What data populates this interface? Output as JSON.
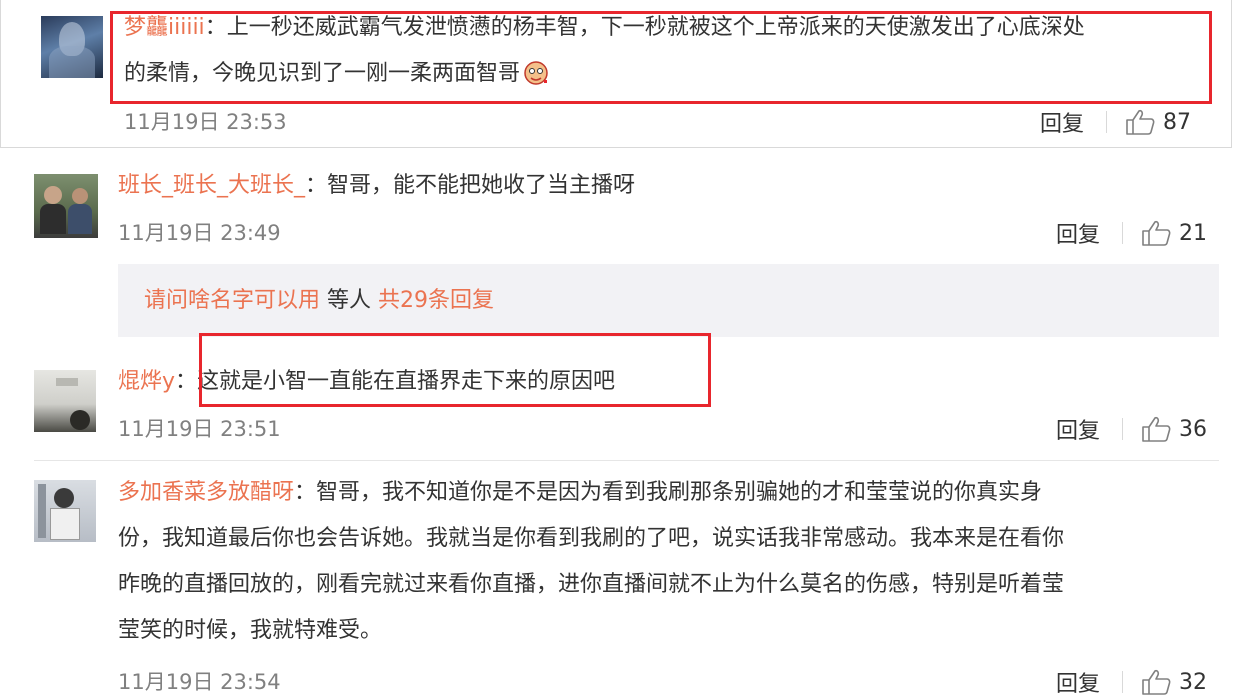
{
  "colors": {
    "username": "#eb7350",
    "highlight_box": "#e8262d",
    "time": "#808080"
  },
  "comments": [
    {
      "username": "梦龘iiiiii",
      "text_line1": "：上一秒还威武霸气发泄愤懑的杨丰智，下一秒就被这个上帝派来的天使激发出了心底深处",
      "text_line2": "的柔情，今晚见识到了一刚一柔两面智哥",
      "time": "11月19日 23:53",
      "reply_label": "回复",
      "likes": "87",
      "emoji": "face-emoji"
    },
    {
      "username": "班长_班长_大班长_",
      "text": "：智哥，能不能把她收了当主播呀",
      "time": "11月19日 23:49",
      "reply_label": "回复",
      "likes": "21"
    },
    {
      "username": "焜烨y",
      "text": "：这就是小智一直能在直播界走下来的原因吧",
      "time": "11月19日 23:51",
      "reply_label": "回复",
      "likes": "36"
    },
    {
      "username": "多加香菜多放醋呀",
      "text_line1": "：智哥，我不知道你是不是因为看到我刷那条别骗她的才和莹莹说的你真实身",
      "text_line2": "份，我知道最后你也会告诉她。我就当是你看到我刷的了吧，说实话我非常感动。我本来是在看你",
      "text_line3": "昨晚的直播回放的，刚看完就过来看你直播，进你直播间就不止为什么莫名的伤感，特别是听着莹",
      "text_line4": "莹笑的时候，我就特难受。",
      "time": "11月19日 23:54",
      "reply_label": "回复",
      "likes": "32"
    }
  ],
  "more_replies": {
    "link1": "请问啥名字可以用",
    "middle": " 等人 ",
    "link2": "共29条回复"
  },
  "icons": {
    "like": "thumbs-up-icon"
  }
}
